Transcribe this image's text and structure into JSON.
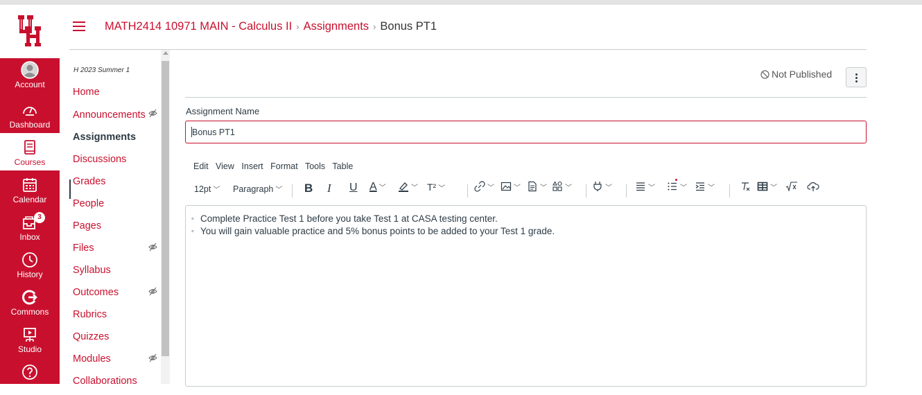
{
  "brand": {
    "accent": "#c8102e",
    "logo": "UH"
  },
  "global_nav": {
    "items": [
      {
        "label": "Account",
        "icon": "account-icon"
      },
      {
        "label": "Dashboard",
        "icon": "dashboard-icon"
      },
      {
        "label": "Courses",
        "icon": "courses-icon"
      },
      {
        "label": "Calendar",
        "icon": "calendar-icon"
      },
      {
        "label": "Inbox",
        "icon": "inbox-icon",
        "badge": "3"
      },
      {
        "label": "History",
        "icon": "history-icon"
      },
      {
        "label": "Commons",
        "icon": "commons-icon"
      },
      {
        "label": "Studio",
        "icon": "studio-icon"
      },
      {
        "label": "",
        "icon": "help-icon"
      }
    ]
  },
  "breadcrumb": {
    "course": "MATH2414 10971 MAIN - Calculus II",
    "section": "Assignments",
    "current": "Bonus PT1",
    "separator": "›"
  },
  "course_nav": {
    "term": "H 2023 Summer 1",
    "items": [
      {
        "label": "Home"
      },
      {
        "label": "Announcements",
        "hidden_icon": true
      },
      {
        "label": "Assignments",
        "active": true
      },
      {
        "label": "Discussions"
      },
      {
        "label": "Grades"
      },
      {
        "label": "People"
      },
      {
        "label": "Pages"
      },
      {
        "label": "Files",
        "hidden_icon": true
      },
      {
        "label": "Syllabus"
      },
      {
        "label": "Outcomes",
        "hidden_icon": true
      },
      {
        "label": "Rubrics"
      },
      {
        "label": "Quizzes"
      },
      {
        "label": "Modules",
        "hidden_icon": true
      },
      {
        "label": "Collaborations"
      }
    ]
  },
  "assignment": {
    "publish_status": "Not Published",
    "name_label": "Assignment Name",
    "name_value": "Bonus PT1"
  },
  "editor": {
    "menus": [
      "Edit",
      "View",
      "Insert",
      "Format",
      "Tools",
      "Table"
    ],
    "font_size": "12pt",
    "block_format": "Paragraph",
    "content": [
      "Complete Practice Test 1 before you take Test 1 at CASA testing center.",
      "You will gain valuable practice and 5% bonus points to be added to your Test 1 grade."
    ]
  }
}
